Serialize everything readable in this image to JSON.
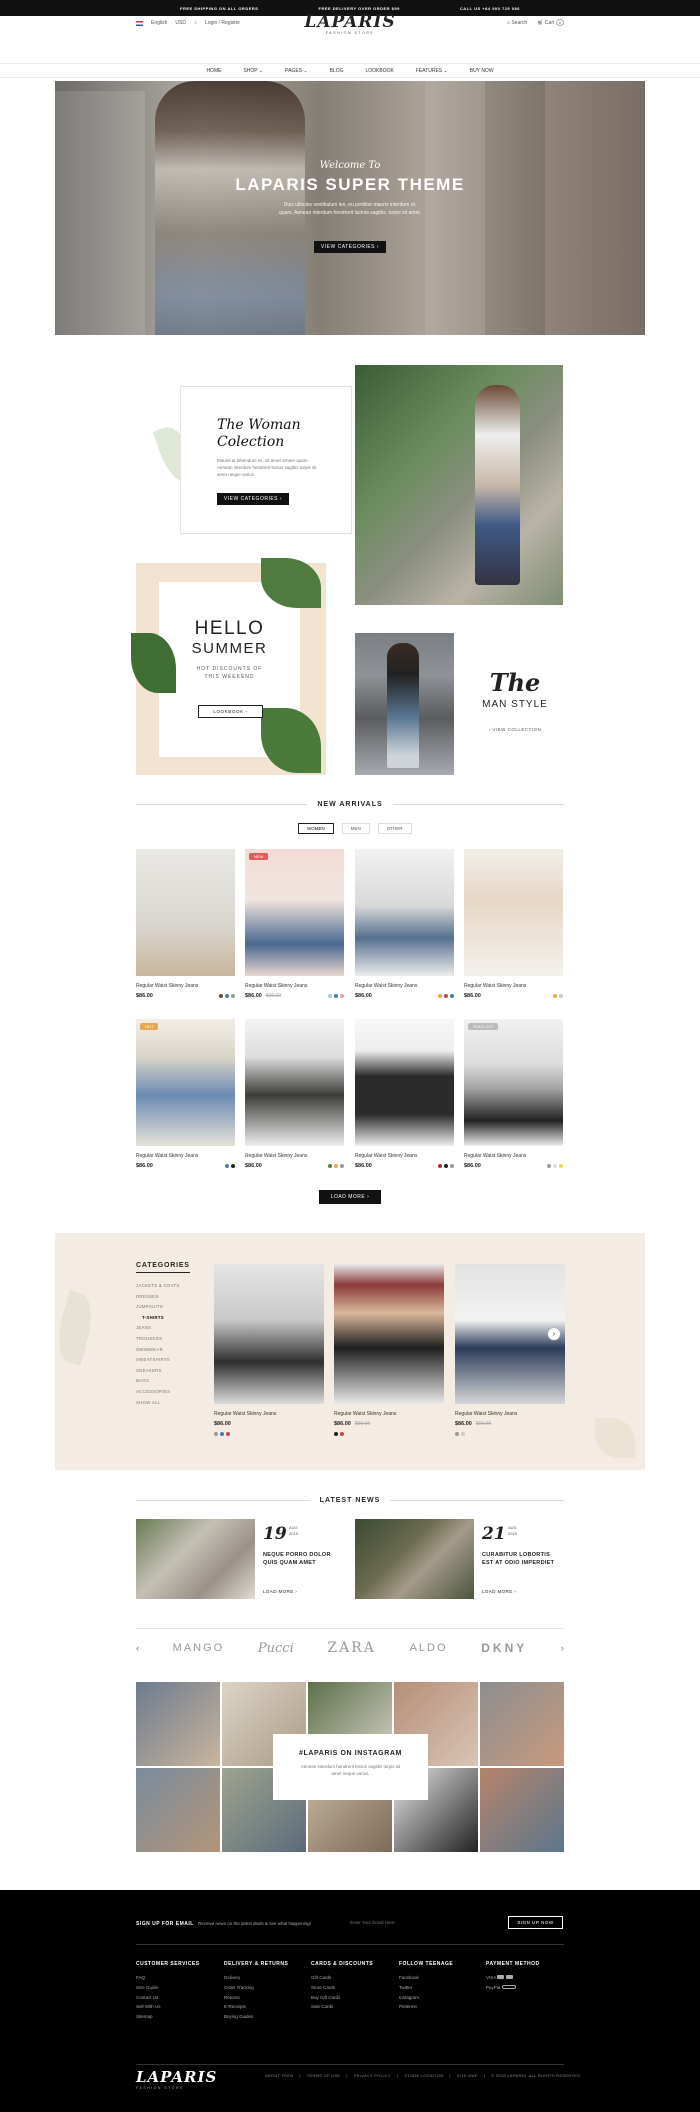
{
  "topbar": {
    "left": "FREE SHIPPING ON ALL ORDERS",
    "center": "FREE DELIVERY OVER ORDER $99",
    "right": "CALL US +84 900 725 086"
  },
  "header": {
    "language": "English",
    "currency": "USD",
    "account": "Login / Register",
    "logo": "LAPARIS",
    "logo_sub": "FASHION STORE",
    "search": "Search",
    "cart": "Cart",
    "cart_count": "0"
  },
  "nav": [
    "HOME",
    "SHOP",
    "PAGES",
    "BLOG",
    "LOOKBOOK",
    "FEATURES",
    "BUY NOW"
  ],
  "hero": {
    "kicker": "Welcome To",
    "title": "LAPARIS SUPER THEME",
    "desc1": "Duis ultricies vestibulum leo, eu porttitor mauris interdum et.",
    "desc2": "quam. Aenean interdum hendrerit lacinia sagittis, turpis sit amet.",
    "button": "VIEW CATEGORIES"
  },
  "woman": {
    "title1": "The Woman",
    "title2": "Colection",
    "text": "Mauris at bibendum ex, sit amet ornare quam. Aenean interdum hendrerit lectus sagittis turpis sit amet neque varius.",
    "button": "VIEW CATEGORIES"
  },
  "summer": {
    "title1": "HELLO",
    "title2": "SUMMER",
    "sub1": "HOT DISCOUNTS OF",
    "sub2": "THIS WEEKEND",
    "button": "LOOKBOOK"
  },
  "man": {
    "title": "The",
    "title2": "MAN STYLE",
    "link": "VIEW COLLECTION"
  },
  "arrivals": {
    "title": "NEW ARRIVALS",
    "tabs": [
      "WOMEN",
      "MEN",
      "OTHER"
    ],
    "load_more": "LOAD MORE",
    "products": [
      {
        "name": "Regular Waist Skinny Jeans",
        "price": "$86.00",
        "old": "",
        "badge": ""
      },
      {
        "name": "Regular Waist Skinny Jeans",
        "price": "$86.00",
        "old": "$96.00",
        "badge": "NEW"
      },
      {
        "name": "Regular Waist Skinny Jeans",
        "price": "$86.00",
        "old": "",
        "badge": ""
      },
      {
        "name": "Regular Waist Skinny Jeans",
        "price": "$86.00",
        "old": "",
        "badge": ""
      },
      {
        "name": "Regular Waist Skinny Jeans",
        "price": "$86.00",
        "old": "",
        "badge": "HOT"
      },
      {
        "name": "Regular Waist Skinny Jeans",
        "price": "$86.00",
        "old": "",
        "badge": ""
      },
      {
        "name": "Regular Waist Skinny Jeans",
        "price": "$86.00",
        "old": "",
        "badge": ""
      },
      {
        "name": "Regular Waist Skinny Jeans",
        "price": "$86.00",
        "old": "",
        "badge": "SOLD OUT"
      }
    ]
  },
  "categories": {
    "title": "CATEGORIES",
    "items": [
      "JACKETS & COATS",
      "DRESSES",
      "JUMPSUITS",
      "T-SHIRTS",
      "JEANS",
      "TROUSERS",
      "SWIMWEAR",
      "SWEATSHIRTS",
      "SNEAKERS",
      "BAGS",
      "ACCESSORIES",
      "SHOW ALL"
    ],
    "products": [
      {
        "name": "Regular Waist Skinny Jeans",
        "price": "$86.00",
        "old": ""
      },
      {
        "name": "Regular Waist Skinny Jeans",
        "price": "$86.00",
        "old": "$96.00"
      },
      {
        "name": "Regular Waist Skinny Jeans",
        "price": "$86.00",
        "old": "$96.00"
      }
    ]
  },
  "news": {
    "title": "LATEST NEWS",
    "posts": [
      {
        "day": "19",
        "month": "AUG",
        "year": "2018",
        "title": "NEQUE PORRO DOLOR QUIS QUAM AMET",
        "more": "LOAD MORE"
      },
      {
        "day": "21",
        "month": "AUG",
        "year": "2018",
        "title": "CURABITUR LOBORTIS EST AT ODIO IMPERDIET",
        "more": "LOAD MORE"
      }
    ]
  },
  "brands": [
    "MANGO",
    "Pucci",
    "ZARA",
    "ALDO",
    "DKNY"
  ],
  "instagram": {
    "title": "#LAPARIS ON INSTAGRAM",
    "text": "Aenean interdum hendrerit lectus sagittis turpis sit amet neque varius."
  },
  "newsletter": {
    "label": "SIGN UP FOR EMAIL",
    "desc": "Receive news on the latest deals & see what happening!",
    "placeholder": "Enter Your Email Here",
    "button": "SIGN UP NOW"
  },
  "footer": {
    "cols": [
      {
        "title": "CUSTOMER SERVICES",
        "links": [
          "FAQ",
          "Size Guide",
          "Contact Us",
          "Sell With Us",
          "Sitemap"
        ]
      },
      {
        "title": "DELIVERY & RETURNS",
        "links": [
          "Delivery",
          "Order Tracking",
          "Returns",
          "E-Receipts",
          "Buying Guides"
        ]
      },
      {
        "title": "CARDS & DISCOUNTS",
        "links": [
          "Gift Cards",
          "Store Cards",
          "Buy Gift Cards",
          "Sale Cards"
        ]
      },
      {
        "title": "FOLLOW TEENAGE",
        "links": [
          "Facebook",
          "Twitter",
          "Instagram",
          "Pinterest"
        ]
      }
    ],
    "payment_title": "PAYMENT METHOD",
    "payment": [
      "VISA",
      "PayPal"
    ],
    "logo": "LAPARIS",
    "logo_sub": "FASHION STORE",
    "links": [
      "ABOUT TEEN",
      "TERMS OF USE",
      "PRIVACY POLICY",
      "STORE LOCATION",
      "SITE MAP"
    ],
    "copyright": "© 2018 LAPARIS. ALL RIGHTS RESERVED"
  }
}
